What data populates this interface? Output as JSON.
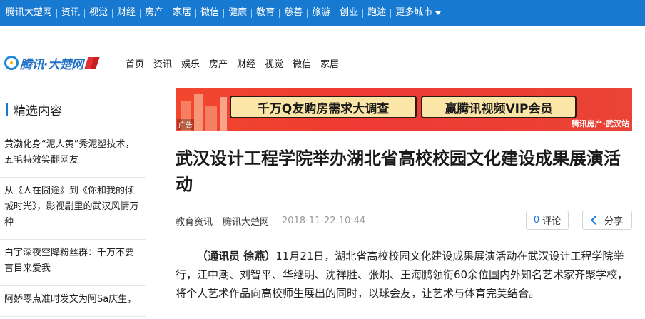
{
  "topnav": {
    "items": [
      "腾讯大楚网",
      "资讯",
      "视觉",
      "财经",
      "房产",
      "家居",
      "微信",
      "健康",
      "教育",
      "慈善",
      "旅游",
      "创业",
      "跑途"
    ],
    "more": "更多城市"
  },
  "brand": {
    "logo_text": "腾讯·大楚网"
  },
  "mainnav": {
    "items": [
      "首页",
      "资讯",
      "娱乐",
      "房产",
      "财经",
      "视觉",
      "微信",
      "家居"
    ]
  },
  "sidebar": {
    "title": "精选内容",
    "items": [
      "黄渤化身“泥人黄”秀泥塑技术，五毛特效笑翻网友",
      "从《人在囧途》到《你和我的倾城时光》，影视剧里的武汉风情万种",
      "白宇深夜空降粉丝群：千万不要盲目来爱我",
      "阿娇零点准时发文为阿Sa庆生，"
    ]
  },
  "banner": {
    "text1": "千万Q友购房需求大调查",
    "text2": "赢腾讯视频VIP会员",
    "ad_label": "广告",
    "brand_label": "腾讯房产·武汉站"
  },
  "article": {
    "title": "武汉设计工程学院举办湖北省高校校园文化建设成果展演活动",
    "category": "教育资讯",
    "source": "腾讯大楚网",
    "time": "2018-11-22 10:44",
    "comment_count": "0",
    "comment_label": "评论",
    "share_label": "分享",
    "byline": "（通讯员 徐燕）",
    "body": "11月21日，湖北省高校校园文化建设成果展演活动在武汉设计工程学院举行，江中潮、刘智平、华继明、沈祥胜、张炯、王海鹏领衔60余位国内外知名艺术家齐聚学校，将个人艺术作品向高校师生展出的同时，以球会友，让艺术与体育完美结合。"
  }
}
